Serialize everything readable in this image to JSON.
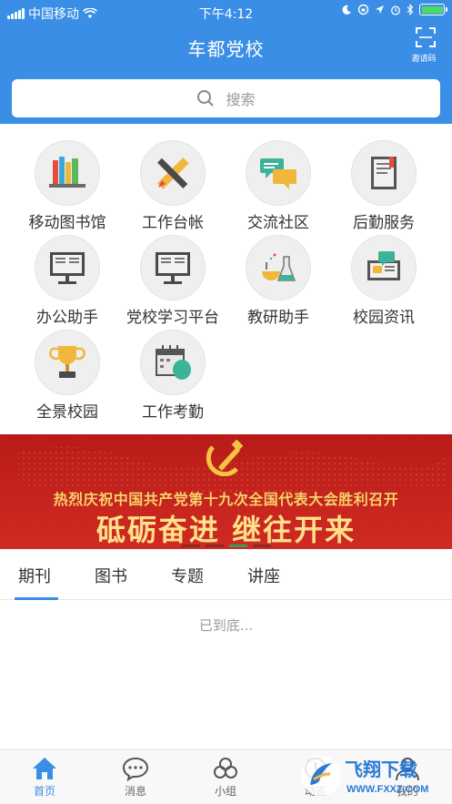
{
  "status_bar": {
    "carrier": "中国移动",
    "time": "下午4:12",
    "battery_level": 1.0
  },
  "header": {
    "title": "车都党校",
    "invite_label": "邀请码",
    "search_placeholder": "搜索",
    "background_color": "#3a8ee6"
  },
  "grid": [
    {
      "label": "移动图书馆",
      "icon": "library-books-icon"
    },
    {
      "label": "工作台帐",
      "icon": "pencil-ruler-icon"
    },
    {
      "label": "交流社区",
      "icon": "chat-bubbles-icon"
    },
    {
      "label": "后勤服务",
      "icon": "document-icon"
    },
    {
      "label": "办公助手",
      "icon": "monitor-book-icon"
    },
    {
      "label": "党校学习平台",
      "icon": "monitor-book-icon"
    },
    {
      "label": "教研助手",
      "icon": "lab-flask-icon"
    },
    {
      "label": "校园资讯",
      "icon": "news-board-icon"
    },
    {
      "label": "全景校园",
      "icon": "trophy-icon"
    },
    {
      "label": "工作考勤",
      "icon": "calendar-icon"
    }
  ],
  "banner": {
    "subtitle": "热烈庆祝中国共产党第十九次全国代表大会胜利召开",
    "headline": "砥砺奋进  继往开来",
    "active_slide": 3,
    "slide_count": 4
  },
  "tabs": [
    {
      "label": "期刊",
      "active": true
    },
    {
      "label": "图书",
      "active": false
    },
    {
      "label": "专题",
      "active": false
    },
    {
      "label": "讲座",
      "active": false
    }
  ],
  "list_end_text": "已到底...",
  "bottom_nav": [
    {
      "label": "首页",
      "icon": "home-icon",
      "active": true
    },
    {
      "label": "消息",
      "icon": "message-icon",
      "active": false
    },
    {
      "label": "小组",
      "icon": "group-icon",
      "active": false
    },
    {
      "label": "动态",
      "icon": "activity-icon",
      "active": false
    },
    {
      "label": "我的",
      "icon": "profile-icon",
      "active": false
    }
  ],
  "watermark": {
    "brand": "飞翔下载",
    "url": "WWW.FXXZ.COM"
  }
}
